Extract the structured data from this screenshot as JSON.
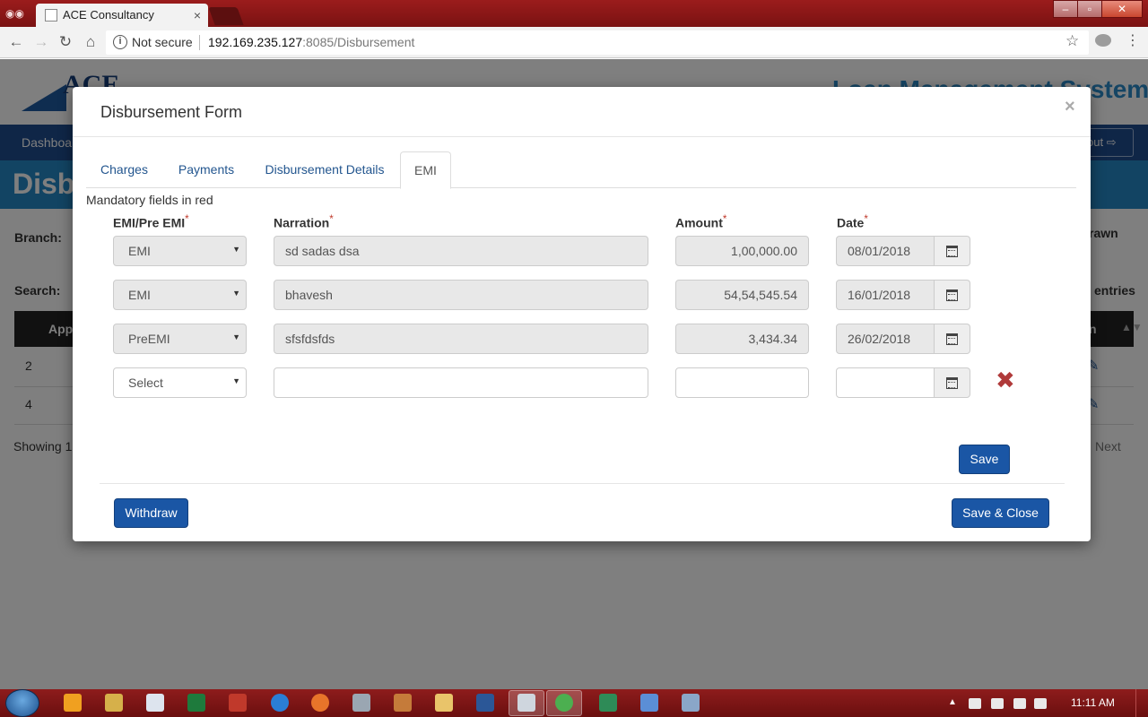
{
  "browser": {
    "tab_title": "ACE Consultancy",
    "tab_close": "×",
    "security_label": "Not secure",
    "url_host": "192.169.235.127",
    "url_rest": ":8085/Disbursement"
  },
  "page": {
    "logo_text": "ACE",
    "system_title": "Loan Management System",
    "nav_dashboard": "Dashboa",
    "logout": "out",
    "banner_title": "Disb",
    "branch_label": "Branch:",
    "search_label": "Search:",
    "drawn_label": "rawn",
    "entries_label": "entries",
    "table_header_app": "App",
    "table_header_n": "n",
    "rows": [
      {
        "id": "2"
      },
      {
        "id": "4"
      }
    ],
    "showing_text": "Showing 1",
    "next_label": "Next"
  },
  "modal": {
    "title": "Disbursement Form",
    "close_symbol": "×",
    "tabs": [
      {
        "label": "Charges"
      },
      {
        "label": "Payments"
      },
      {
        "label": "Disbursement Details"
      },
      {
        "label": "EMI",
        "active": true
      }
    ],
    "mandatory_note": "Mandatory fields in red",
    "columns": {
      "emi_type": "EMI/Pre EMI",
      "narration": "Narration",
      "amount": "Amount",
      "date": "Date",
      "required_marker": "*"
    },
    "rows": [
      {
        "type": "EMI",
        "narration": "sd sadas dsa",
        "amount": "1,00,000.00",
        "date": "08/01/2018"
      },
      {
        "type": "EMI",
        "narration": "bhavesh",
        "amount": "54,54,545.54",
        "date": "16/01/2018"
      },
      {
        "type": "PreEMI",
        "narration": "sfsfdsfds",
        "amount": "3,434.34",
        "date": "26/02/2018"
      }
    ],
    "new_row": {
      "type_placeholder": "Select",
      "narration": "",
      "amount": "",
      "date": ""
    },
    "save_label": "Save",
    "withdraw_label": "Withdraw",
    "save_close_label": "Save & Close"
  },
  "taskbar": {
    "clock": "11:11 AM"
  },
  "colors": {
    "primary": "#1a56a5",
    "required": "#c0392b",
    "remove": "#b03a3a"
  }
}
